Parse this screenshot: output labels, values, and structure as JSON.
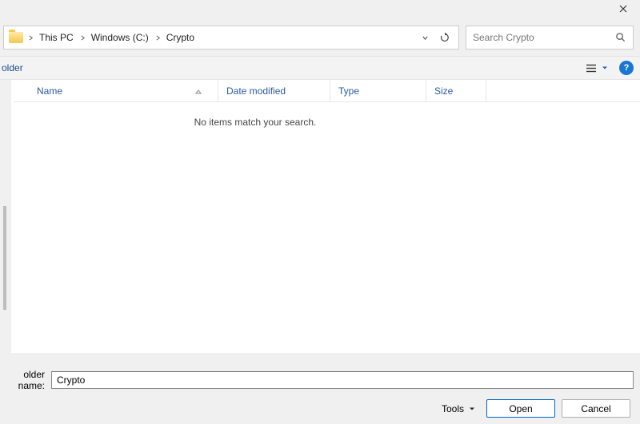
{
  "titlebar": {
    "close": "✕"
  },
  "breadcrumbs": {
    "items": [
      "This PC",
      "Windows (C:)",
      "Crypto"
    ]
  },
  "refresh_label": "Refresh",
  "search": {
    "placeholder": "Search Crypto"
  },
  "toolbar": {
    "left_label": "older",
    "help": "?"
  },
  "columns": {
    "name": "Name",
    "date": "Date modified",
    "type": "Type",
    "size": "Size"
  },
  "empty_message": "No items match your search.",
  "footer": {
    "name_label": "older name:",
    "name_value": "Crypto",
    "tools": "Tools",
    "open": "Open",
    "cancel": "Cancel"
  }
}
